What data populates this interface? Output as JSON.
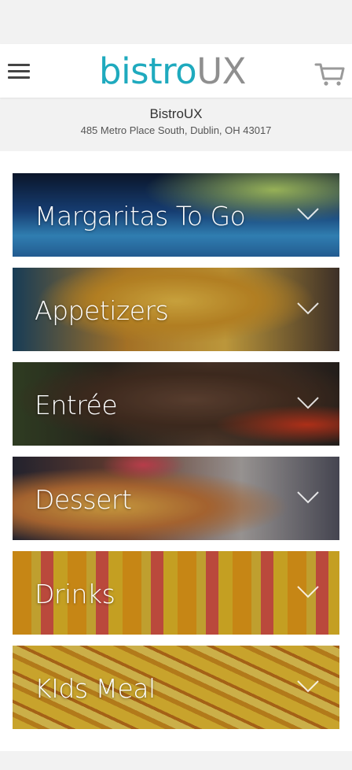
{
  "header": {
    "logo_part1": "bistro",
    "logo_part2": "UX",
    "menu_icon": "hamburger-icon",
    "cart_icon": "cart-icon"
  },
  "restaurant": {
    "name": "BistroUX",
    "address": "485 Metro Place South, Dublin, OH 43017"
  },
  "categories": [
    {
      "label": "Margaritas To Go",
      "icon": "chevron-down-icon"
    },
    {
      "label": "Appetizers",
      "icon": "chevron-down-icon"
    },
    {
      "label": "Entrée",
      "icon": "chevron-down-icon"
    },
    {
      "label": "Dessert",
      "icon": "chevron-down-icon"
    },
    {
      "label": "Drinks",
      "icon": "chevron-down-icon"
    },
    {
      "label": "KIds Meal",
      "icon": "chevron-down-icon"
    }
  ],
  "colors": {
    "brand_primary": "#1faabe",
    "brand_secondary": "#8f8f8f",
    "page_background": "#f2f2f2"
  }
}
